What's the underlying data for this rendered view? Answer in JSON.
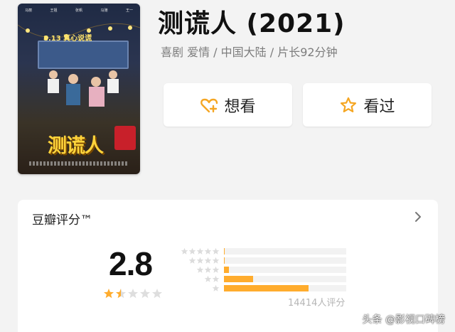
{
  "movie": {
    "title": "测谎人 (2021)",
    "meta": "喜剧 爱情 / 中国大陆 / 片长92分钟"
  },
  "poster": {
    "title": "测谎人",
    "tagline": "8.13 真心说谎",
    "cast": [
      "马丽",
      "王祖",
      "张帆",
      "马驰",
      "王一"
    ]
  },
  "actions": {
    "want_label": "想看",
    "seen_label": "看过"
  },
  "rating": {
    "header": "豆瓣评分™",
    "score": "2.8",
    "score_stars": 1.5,
    "distribution": [
      {
        "stars": 5,
        "percent": 0.5
      },
      {
        "stars": 4,
        "percent": 0.5
      },
      {
        "stars": 3,
        "percent": 4
      },
      {
        "stars": 2,
        "percent": 24
      },
      {
        "stars": 1,
        "percent": 69
      }
    ],
    "count": "14414人评分"
  },
  "watermark": "头条 @影视口碑榜",
  "colors": {
    "accent": "#ffac2d",
    "star_empty": "#dedede",
    "bar_bg": "#f2f2f2"
  }
}
